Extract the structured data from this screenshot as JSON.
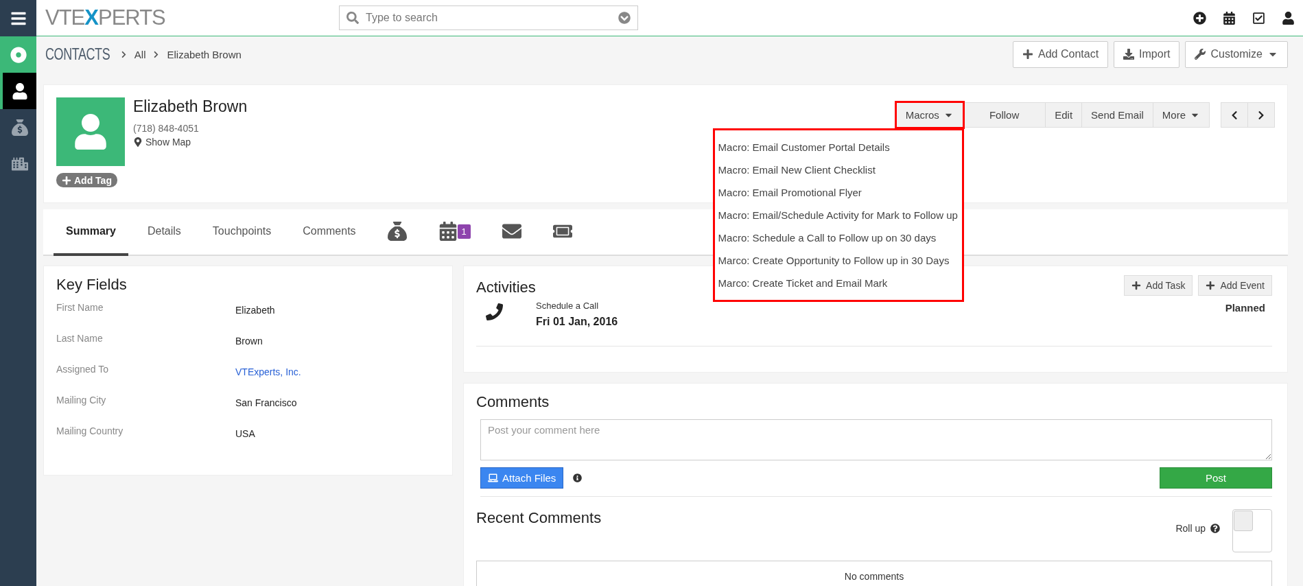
{
  "top_bar": {
    "logo": {
      "parts": [
        "VTE",
        "X",
        "PERTS"
      ]
    },
    "search": {
      "placeholder": "Type to search"
    }
  },
  "sidebar": {
    "items": [
      {
        "selected": true
      },
      {
        "selected": false
      },
      {
        "selected": false
      }
    ]
  },
  "breadcrumb": {
    "module": "CONTACTS",
    "items": [
      "All",
      "Elizabeth Brown"
    ]
  },
  "header_actions": [
    {
      "label": "Add Contact",
      "dropdown": false
    },
    {
      "label": "Import",
      "dropdown": false
    },
    {
      "label": "Customize",
      "dropdown": true
    }
  ],
  "record": {
    "name": "Elizabeth Brown",
    "phone": "(718) 848-4051",
    "map_link": "Show Map",
    "tag_button": "Add Tag"
  },
  "actions": [
    {
      "label": "Macros",
      "dropdown": true,
      "expanded": true,
      "highlighted": true,
      "menu": [
        "Macro: Email Customer Portal Details",
        "Macro: Email New Client Checklist",
        "Macro: Email Promotional Flyer",
        "Macro: Email/Schedule Activity for Mark to Follow up",
        "Macro: Schedule a Call to Follow up on 30 days",
        "Marco: Create Opportunity to Follow up in 30 Days",
        "Marco: Create Ticket and Email Mark"
      ]
    },
    {
      "label": "Follow",
      "dropdown": false,
      "expanded": false,
      "highlighted": false
    },
    {
      "label": "Edit",
      "dropdown": false,
      "expanded": false,
      "highlighted": false
    },
    {
      "label": "Send Email",
      "dropdown": false,
      "expanded": false,
      "highlighted": false
    },
    {
      "label": "More",
      "dropdown": true,
      "expanded": false,
      "highlighted": false
    }
  ],
  "tabs": [
    {
      "kind": "text",
      "label": "Summary",
      "selected": true
    },
    {
      "kind": "text",
      "label": "Details",
      "selected": false
    },
    {
      "kind": "text",
      "label": "Touchpoints",
      "selected": false
    },
    {
      "kind": "text",
      "label": "Comments",
      "selected": false
    },
    {
      "kind": "icon",
      "selected": false
    },
    {
      "kind": "icon",
      "selected": false,
      "badge": "1"
    },
    {
      "kind": "icon",
      "selected": false
    },
    {
      "kind": "icon",
      "selected": false
    }
  ],
  "key_fields": {
    "title": "Key Fields",
    "rows": [
      {
        "label": "First Name",
        "value": "Elizabeth",
        "link": false
      },
      {
        "label": "Last Name",
        "value": "Brown",
        "link": false
      },
      {
        "label": "Assigned To",
        "value": "VTExperts, Inc.",
        "link": true
      },
      {
        "label": "Mailing City",
        "value": "San Francisco",
        "link": false
      },
      {
        "label": "Mailing Country",
        "value": "USA",
        "link": false
      }
    ]
  },
  "activities": {
    "title": "Activities",
    "buttons": [
      "Add Task",
      "Add Event"
    ],
    "items": [
      {
        "title": "Schedule a Call",
        "date": "Fri 01 Jan, 2016",
        "status": "Planned"
      }
    ]
  },
  "comments": {
    "title": "Comments",
    "input": {
      "placeholder": "Post your comment here"
    },
    "attach_button": "Attach Files",
    "post_button": "Post",
    "recent_title": "Recent Comments",
    "rollup_label": "Roll up",
    "rollup_checked": false,
    "empty_text": "No comments"
  }
}
